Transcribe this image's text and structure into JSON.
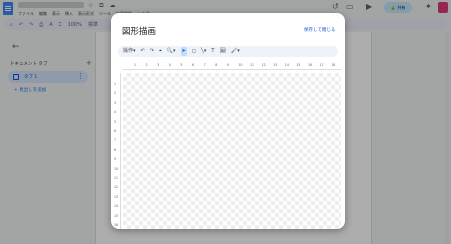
{
  "app": {
    "menu": [
      "ファイル",
      "編集",
      "表示",
      "挿入",
      "表示形式",
      "ツール",
      "拡張機能",
      "ヘルプ"
    ],
    "share_label": "共有",
    "toolbar": {
      "zoom": "100%",
      "style": "標準"
    }
  },
  "sidebar": {
    "title": "ドキュメント タブ",
    "tab_label": "タブ 1",
    "outline_link": "+ 見出しを追加"
  },
  "dialog": {
    "title": "図形描画",
    "save_close": "保存して閉じる",
    "tools": {
      "actions_menu": "操作",
      "undo": "↶",
      "redo": "↷",
      "format": "⌖",
      "zoom": "🔍",
      "select": "➤",
      "shape": "◻",
      "line": "╲",
      "text": "T",
      "image": "🖼",
      "fill": "🖌"
    },
    "ruler_h": [
      "1",
      "2",
      "3",
      "4",
      "5",
      "6",
      "7",
      "8",
      "9",
      "10",
      "11",
      "12",
      "13",
      "14",
      "15",
      "16",
      "17",
      "18"
    ],
    "ruler_v": [
      "1",
      "2",
      "3",
      "4",
      "5",
      "6",
      "7",
      "8",
      "9",
      "10",
      "11",
      "12",
      "13",
      "14",
      "15",
      "16"
    ]
  }
}
